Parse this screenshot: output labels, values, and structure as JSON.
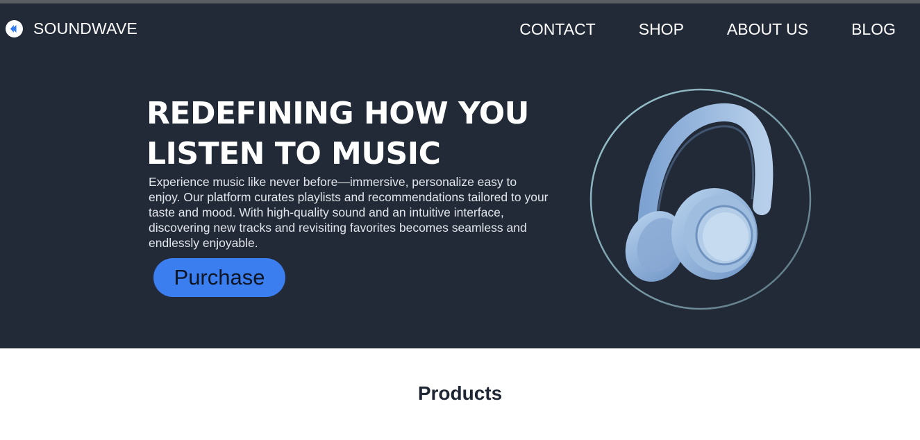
{
  "header": {
    "brand": "SOUNDWAVE",
    "logo_icon": "play-circle-icon",
    "nav": [
      {
        "label": "CONTACT"
      },
      {
        "label": "SHOP"
      },
      {
        "label": "ABOUT US"
      },
      {
        "label": "BLOG"
      }
    ]
  },
  "hero": {
    "headline_line1": "REDEFINING HOW YOU",
    "headline_line2": "LISTEN TO MUSIC",
    "description": "Experience music like never before—immersive, personalize easy to enjoy. Our platform curates playlists and recommendations tailored to your taste and mood. With high-quality sound and an intuitive interface, discovering new tracks and revisiting favorites becomes seamless and endlessly enjoyable.",
    "cta_label": "Purchase",
    "image": "headphones-image"
  },
  "products": {
    "title": "Products"
  },
  "colors": {
    "hero_background": "#222a38",
    "button": "#3a7ef0",
    "headphones": "#9dbbe0"
  }
}
